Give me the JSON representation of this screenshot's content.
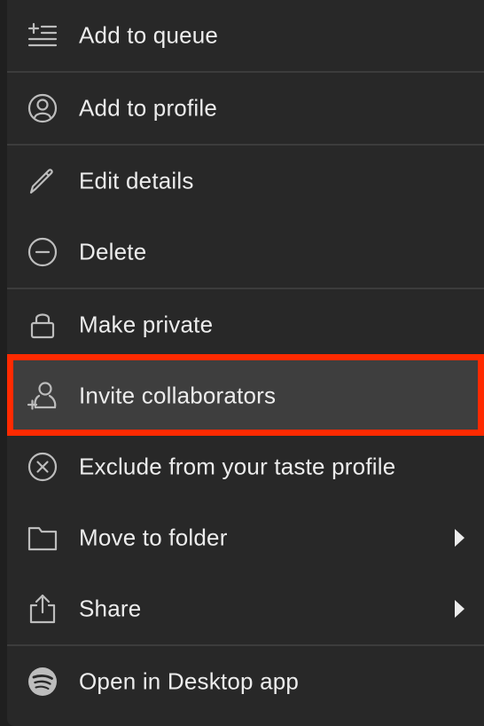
{
  "menu": {
    "items": [
      {
        "label": "Add to queue",
        "icon": "add-to-queue-icon",
        "has_submenu": false
      },
      {
        "label": "Add to profile",
        "icon": "profile-icon",
        "has_submenu": false
      },
      {
        "label": "Edit details",
        "icon": "pencil-icon",
        "has_submenu": false
      },
      {
        "label": "Delete",
        "icon": "minus-circle-icon",
        "has_submenu": false
      },
      {
        "label": "Make private",
        "icon": "lock-icon",
        "has_submenu": false
      },
      {
        "label": "Invite collaborators",
        "icon": "add-user-icon",
        "has_submenu": false,
        "highlighted": true
      },
      {
        "label": "Exclude from your taste profile",
        "icon": "x-circle-icon",
        "has_submenu": false
      },
      {
        "label": "Move to folder",
        "icon": "folder-icon",
        "has_submenu": true
      },
      {
        "label": "Share",
        "icon": "share-icon",
        "has_submenu": true
      },
      {
        "label": "Open in Desktop app",
        "icon": "spotify-icon",
        "has_submenu": false
      }
    ]
  },
  "colors": {
    "menu_background": "#282828",
    "hover_background": "#3e3e3e",
    "highlight_border": "#ff2a00",
    "text": "#ececec",
    "icon": "#b3b3b3"
  }
}
